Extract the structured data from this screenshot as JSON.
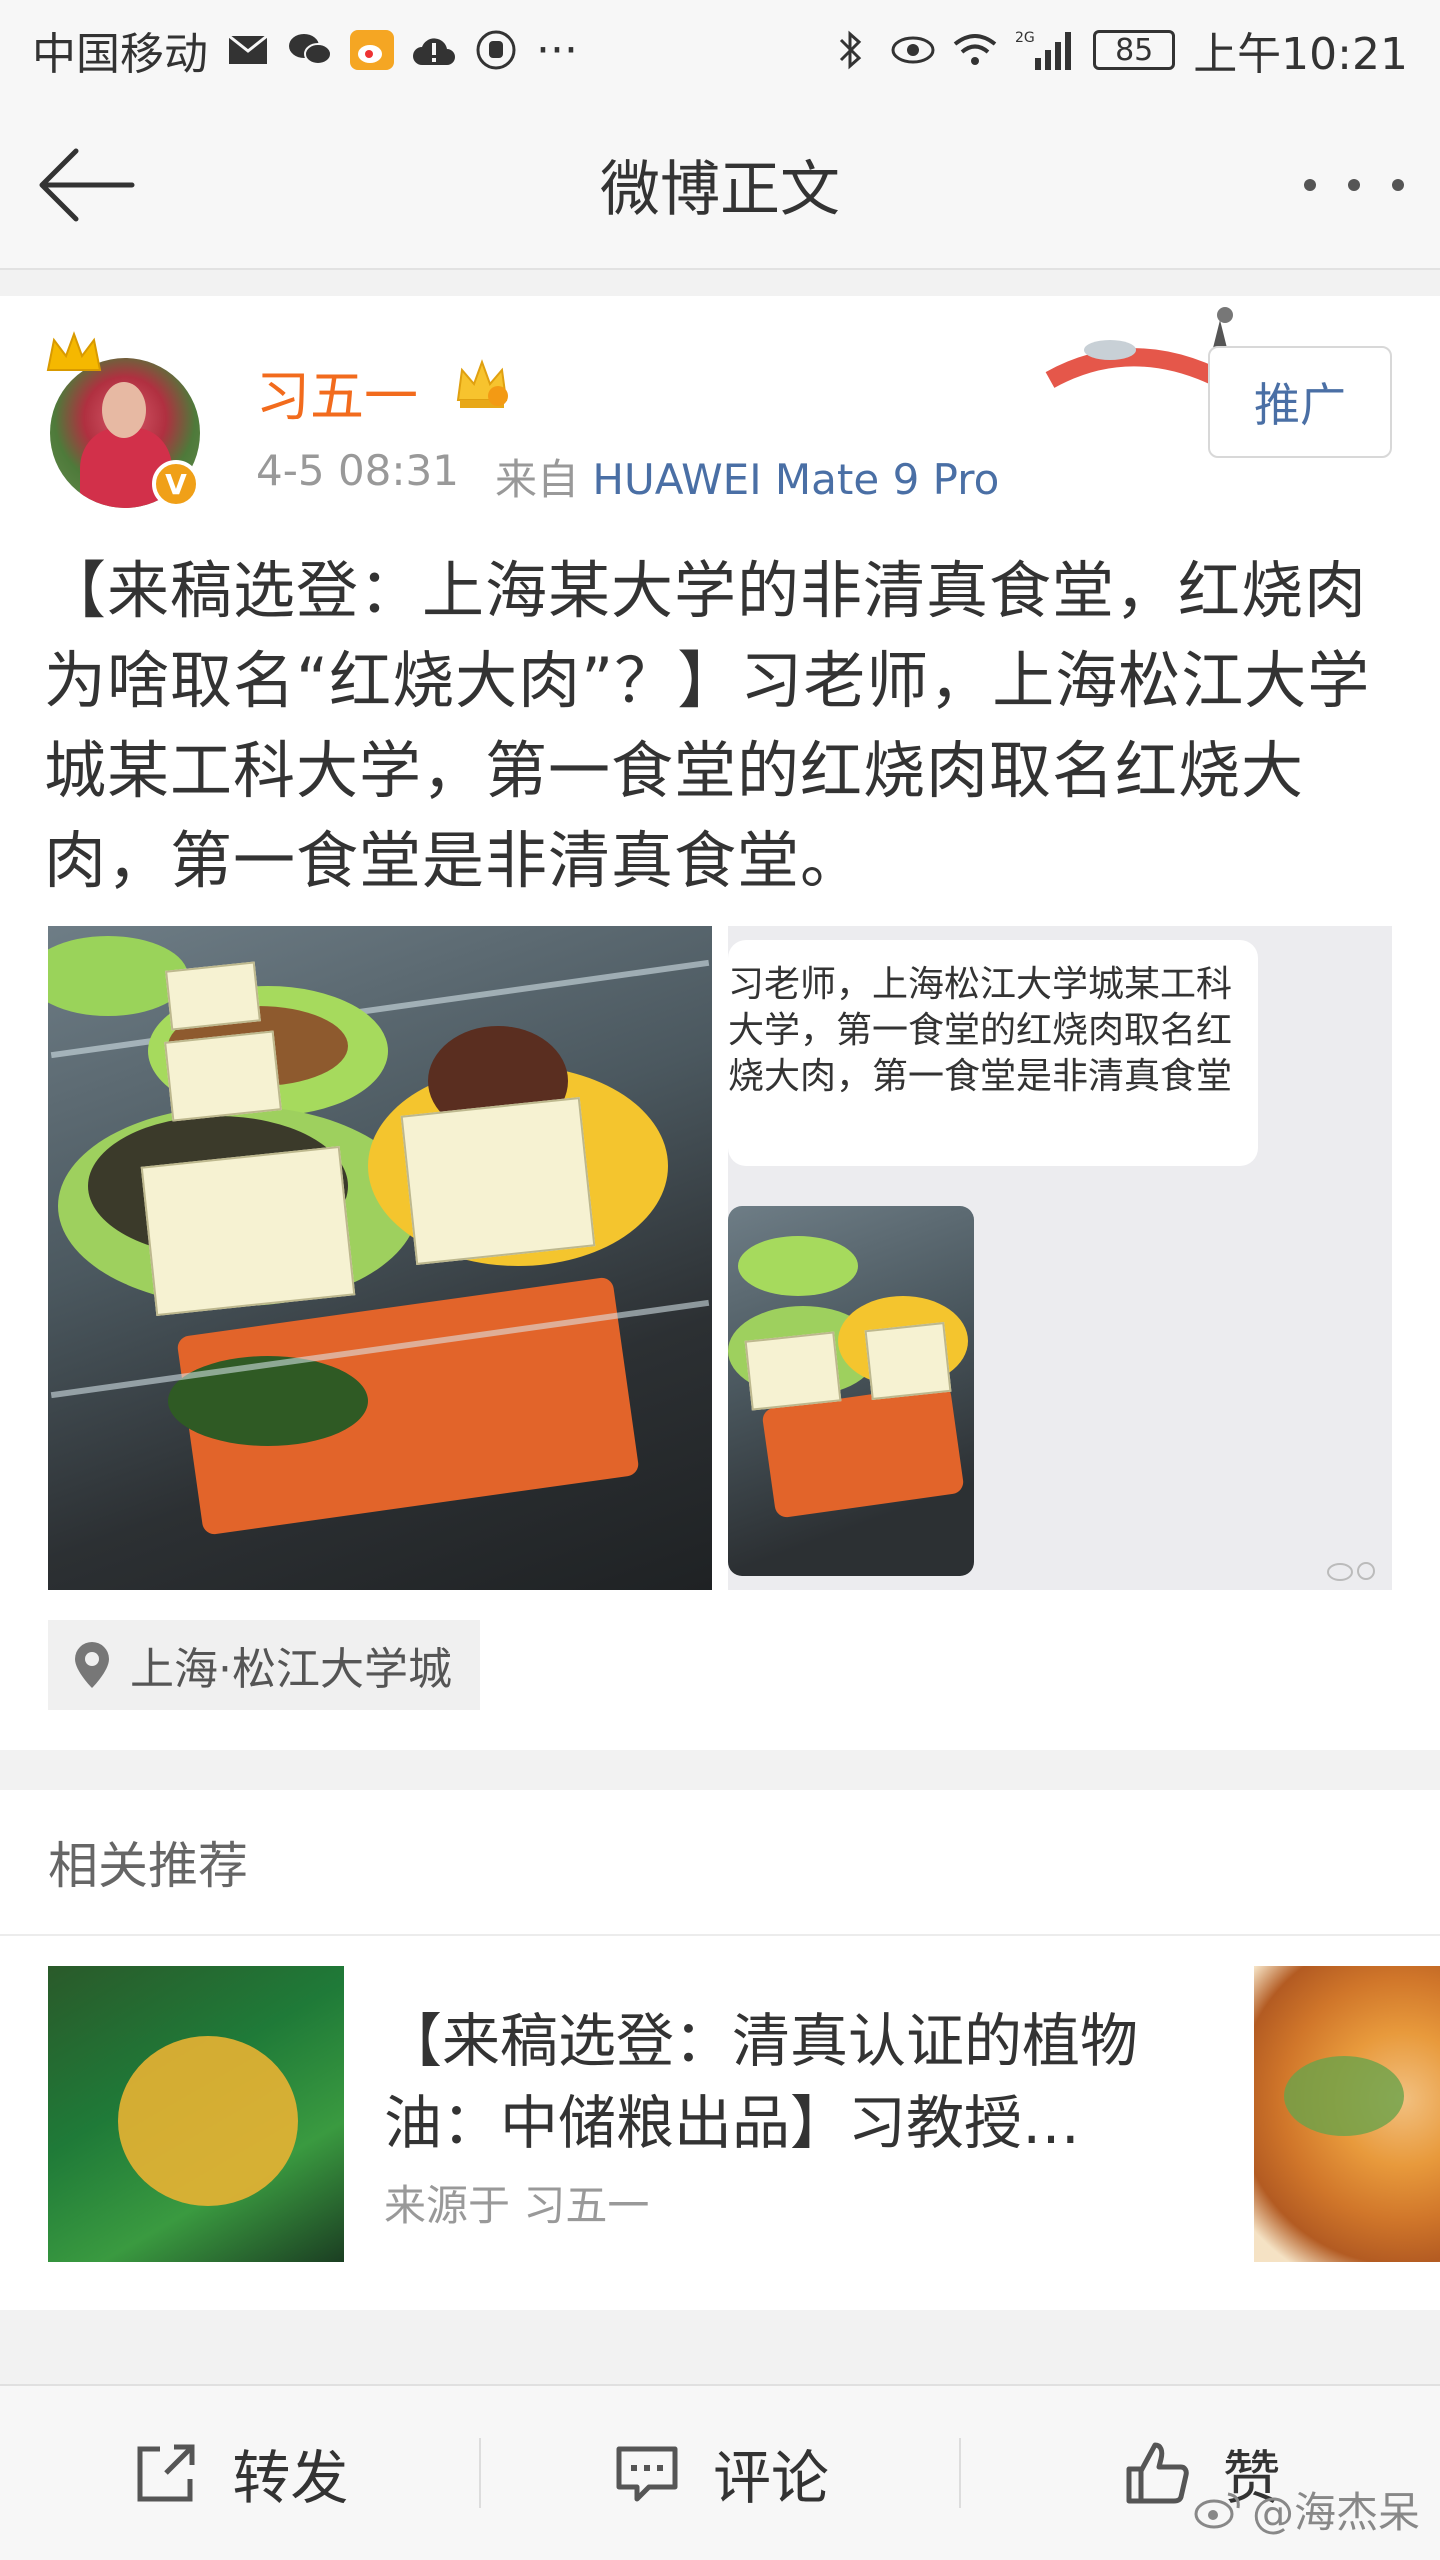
{
  "status_bar": {
    "carrier": "中国移动",
    "network": "2G",
    "battery": "85",
    "time": "上午10:21",
    "more": "···"
  },
  "title_bar": {
    "title": "微博正文"
  },
  "post": {
    "username": "习五一",
    "time": "4-5 08:31",
    "source_prefix": "来自",
    "source_device": "HUAWEI Mate 9 Pro",
    "promote_label": "推广",
    "text": "【来稿选登：上海某大学的非清真食堂，红烧肉为啥取名“红烧大肉”？】习老师，上海松江大学城某工科大学，第一食堂的红烧肉取名红烧大肉，第一食堂是非清真食堂。",
    "image_chat_text": "习老师，上海松江大学城某工科大学，第一食堂的红烧肉取名红烧大肉，第一食堂是非清真食堂",
    "location": "上海·松江大学城"
  },
  "related": {
    "header": "相关推荐",
    "item": {
      "title": "【来稿选登：清真认证的植物油：中储粮出品】习教授…",
      "source": "来源于 习五一"
    }
  },
  "bottom_bar": {
    "repost": "转发",
    "comment": "评论",
    "like": "赞",
    "watermark": "@海杰呆"
  },
  "colors": {
    "username": "#f26b1d",
    "link": "#4a6fa5",
    "badge": "#f0a018"
  }
}
